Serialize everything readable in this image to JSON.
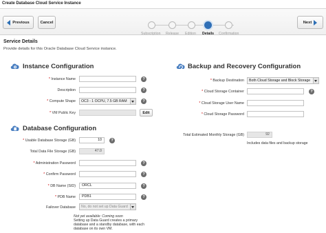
{
  "header": {
    "title": "Create Database Cloud Service Instance"
  },
  "wizard": {
    "previous_label": "Previous",
    "cancel_label": "Cancel",
    "next_label": "Next",
    "steps": [
      {
        "label": "Subscription",
        "active": false
      },
      {
        "label": "Release",
        "active": false
      },
      {
        "label": "Edition",
        "active": false
      },
      {
        "label": "Details",
        "active": true
      },
      {
        "label": "Confirmation",
        "active": false
      }
    ]
  },
  "page": {
    "heading": "Service Details",
    "subheading": "Provide details for this Oracle Database Cloud Service instance."
  },
  "instance": {
    "title": "Instance Configuration",
    "name_label": "Instance Name",
    "name_value": "",
    "description_label": "Description",
    "description_value": "",
    "shape_label": "Compute Shape",
    "shape_value": "OC3 - 1 OCPU, 7.5 GB RAM",
    "vm_key_label": "VM Public Key",
    "vm_key_value": "",
    "edit_label": "Edit"
  },
  "database": {
    "title": "Database Configuration",
    "storage_label": "Usable Database Storage (GB)",
    "storage_value": "10",
    "total_storage_label": "Total Data File Storage (GB)",
    "total_storage_value": "47.0",
    "admin_pw_label": "Administration Password",
    "admin_pw_value": "",
    "confirm_pw_label": "Confirm Password",
    "confirm_pw_value": "",
    "sid_label": "DB Name (SID)",
    "sid_value": "ORCL",
    "pdb_label": "PDB Name",
    "pdb_value": "PDB1",
    "failover_label": "Failover Database",
    "failover_value": "No, do not set up Data Guard",
    "note_line1": "Not yet available: Coming soon",
    "note_line2": "Setting up Data Guard creates a primary",
    "note_line3": "database and a standby database, with each",
    "note_line4": "database on its own VM."
  },
  "backup": {
    "title": "Backup and Recovery Configuration",
    "destination_label": "Backup Destination",
    "destination_value": "Both Cloud Storage and Block Storage",
    "container_label": "Cloud Storage Container",
    "container_value": "",
    "user_label": "Cloud Storage User Name",
    "user_value": "",
    "password_label": "Cloud Storage Password",
    "password_value": "",
    "total_label": "Total Estimated Monthly Storage (GB)",
    "total_value": "92",
    "total_note": "Includes data files and backup storage"
  },
  "colors": {
    "accent": "#2f6fb6",
    "required": "#cc0000"
  },
  "icons": {
    "instance": "cloud-gear-icon",
    "database": "cloud-database-icon",
    "backup": "cloud-refresh-icon",
    "help": "help-icon"
  }
}
